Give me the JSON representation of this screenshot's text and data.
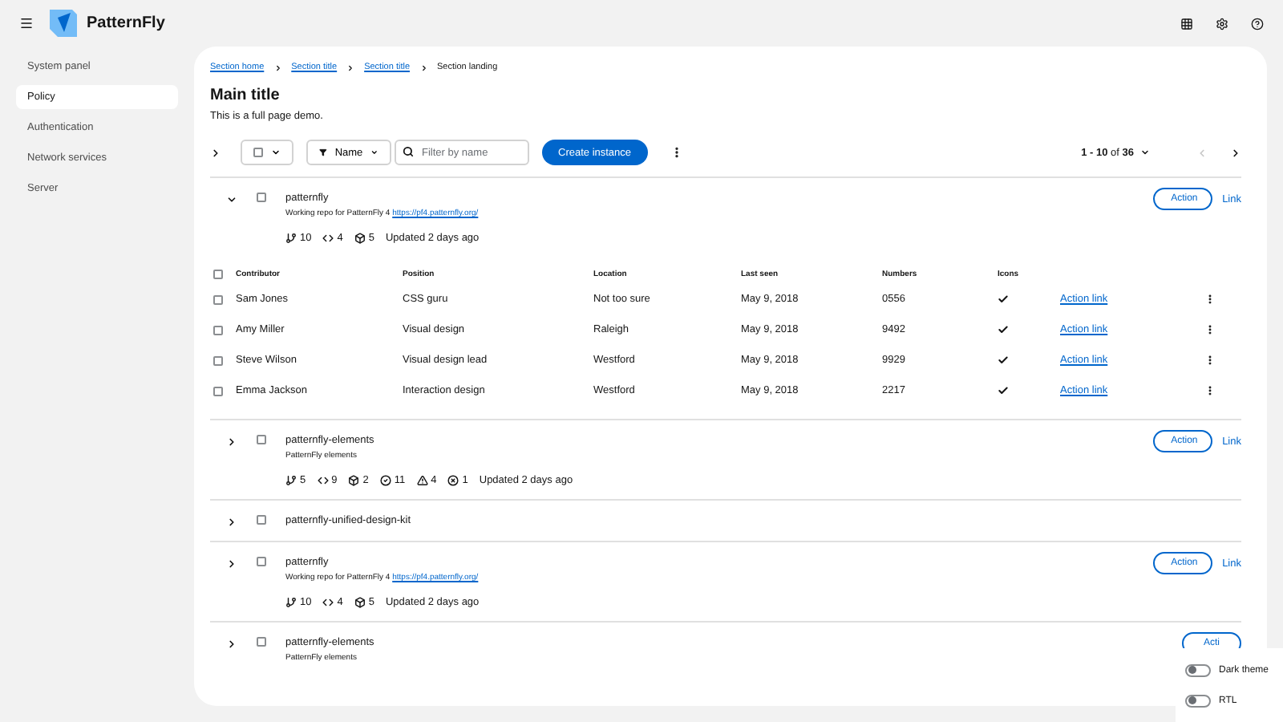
{
  "header": {
    "logo": "PatternFly"
  },
  "sidebar": {
    "items": [
      {
        "label": "System panel",
        "selected": false
      },
      {
        "label": "Policy",
        "selected": true
      },
      {
        "label": "Authentication",
        "selected": false
      },
      {
        "label": "Network services",
        "selected": false
      },
      {
        "label": "Server",
        "selected": false
      }
    ]
  },
  "breadcrumb": [
    {
      "label": "Section home",
      "link": true
    },
    {
      "label": "Section title",
      "link": true
    },
    {
      "label": "Section title",
      "link": true
    },
    {
      "label": "Section landing",
      "link": false
    }
  ],
  "page": {
    "title": "Main title",
    "description": "This is a full page demo."
  },
  "toolbar": {
    "bulk_checked": false,
    "filter": "Name",
    "search_placeholder": "Filter by name",
    "create_button": "Create instance",
    "pagination": {
      "range": "1 - 10",
      "of": "of",
      "total": "36"
    }
  },
  "repos": [
    {
      "name": "patternfly",
      "expanded": true,
      "checked": false,
      "description": "Working repo for PatternFly 4",
      "url": "https://pf4.patternfly.org/",
      "stats": [
        {
          "kind": "branch",
          "value": "10"
        },
        {
          "kind": "code",
          "value": "4"
        },
        {
          "kind": "cube",
          "value": "5"
        }
      ],
      "updated": "Updated 2 days ago",
      "action": "Action",
      "link": "Link",
      "table": {
        "all_checked": false,
        "columns": [
          "Contributor",
          "Position",
          "Location",
          "Last seen",
          "Numbers",
          "Icons"
        ],
        "rows": [
          {
            "checked": false,
            "contributor": "Sam Jones",
            "position": "CSS guru",
            "location": "Not too sure",
            "last_seen": "May 9, 2018",
            "number": "0556",
            "icon": true,
            "action": "Action link"
          },
          {
            "checked": false,
            "contributor": "Amy Miller",
            "position": "Visual design",
            "location": "Raleigh",
            "last_seen": "May 9, 2018",
            "number": "9492",
            "icon": true,
            "action": "Action link"
          },
          {
            "checked": false,
            "contributor": "Steve Wilson",
            "position": "Visual design lead",
            "location": "Westford",
            "last_seen": "May 9, 2018",
            "number": "9929",
            "icon": true,
            "action": "Action link"
          },
          {
            "checked": false,
            "contributor": "Emma Jackson",
            "position": "Interaction design",
            "location": "Westford",
            "last_seen": "May 9, 2018",
            "number": "2217",
            "icon": true,
            "action": "Action link"
          }
        ]
      }
    },
    {
      "name": "patternfly-elements",
      "expanded": false,
      "checked": false,
      "description": "PatternFly elements",
      "stats": [
        {
          "kind": "branch",
          "value": "5"
        },
        {
          "kind": "code",
          "value": "9"
        },
        {
          "kind": "cube",
          "value": "2"
        },
        {
          "kind": "check",
          "value": "11"
        },
        {
          "kind": "warning",
          "value": "4"
        },
        {
          "kind": "error",
          "value": "1"
        }
      ],
      "updated": "Updated 2 days ago",
      "action": "Action",
      "link": "Link"
    },
    {
      "name": "patternfly-unified-design-kit",
      "expanded": false,
      "checked": false
    },
    {
      "name": "patternfly",
      "expanded": false,
      "checked": false,
      "description": "Working repo for PatternFly 4",
      "url": "https://pf4.patternfly.org/",
      "stats": [
        {
          "kind": "branch",
          "value": "10"
        },
        {
          "kind": "code",
          "value": "4"
        },
        {
          "kind": "cube",
          "value": "5"
        }
      ],
      "updated": "Updated 2 days ago",
      "action": "Action",
      "link": "Link"
    },
    {
      "name": "patternfly-elements",
      "expanded": false,
      "checked": false,
      "description": "PatternFly elements",
      "action": "Acti"
    }
  ],
  "settings": [
    {
      "label": "Dark theme",
      "on": false
    },
    {
      "label": "RTL",
      "on": false
    }
  ]
}
